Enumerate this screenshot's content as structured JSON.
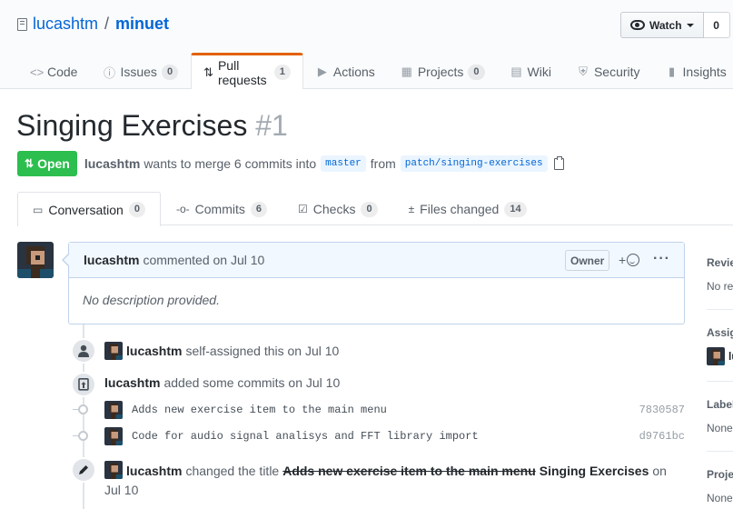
{
  "repo": {
    "owner": "lucashtm",
    "separator": "/",
    "name": "minuet"
  },
  "watch": {
    "label": "Watch",
    "count": "0"
  },
  "nav": [
    {
      "icon": "<>",
      "label": "Code",
      "count": null
    },
    {
      "icon": "ⓘ",
      "label": "Issues",
      "count": "0"
    },
    {
      "icon": "⇅",
      "label": "Pull requests",
      "count": "1"
    },
    {
      "icon": "▶",
      "label": "Actions",
      "count": null
    },
    {
      "icon": "▦",
      "label": "Projects",
      "count": "0"
    },
    {
      "icon": "▤",
      "label": "Wiki",
      "count": null
    },
    {
      "icon": "⛨",
      "label": "Security",
      "count": null
    },
    {
      "icon": "▮",
      "label": "Insights",
      "count": null
    }
  ],
  "pr": {
    "title": "Singing Exercises",
    "number": "#1",
    "state": "Open",
    "author": "lucashtm",
    "summary_prefix": "wants to merge 6 commits into",
    "base_branch": "master",
    "from_word": "from",
    "head_branch": "patch/singing-exercises"
  },
  "tabs": [
    {
      "label": "Conversation",
      "count": "0"
    },
    {
      "label": "Commits",
      "count": "6"
    },
    {
      "label": "Checks",
      "count": "0"
    },
    {
      "label": "Files changed",
      "count": "14"
    }
  ],
  "comment": {
    "author": "lucashtm",
    "action": "commented on Jul 10",
    "role": "Owner",
    "react": "+",
    "more": "···",
    "body": "No description provided."
  },
  "events": {
    "assigned": {
      "author": "lucashtm",
      "text": "self-assigned this on Jul 10"
    },
    "commits": {
      "author": "lucashtm",
      "text": "added some commits on Jul 10"
    },
    "retitle": {
      "author": "lucashtm",
      "verb": "changed the title",
      "old_title": "Adds new exercise item to the main menu",
      "new_title": "Singing Exercises",
      "on": "on",
      "date": "Jul 10"
    }
  },
  "commits": [
    {
      "message": "Adds new exercise item to the main menu",
      "sha": "7830587"
    },
    {
      "message": "Code for audio signal analisys and FFT library import",
      "sha": "d9761bc"
    }
  ],
  "sidebar": {
    "reviewers": {
      "heading": "Revie",
      "value": "No re"
    },
    "assignees": {
      "heading": "Assig",
      "value": "lu"
    },
    "labels": {
      "heading": "Label",
      "value": "None"
    },
    "projects": {
      "heading": "Proje",
      "value": "None"
    }
  },
  "colors": {
    "accent": "#0366d6",
    "open_state": "#2cbe4e",
    "selected_tab_border": "#e36209"
  }
}
